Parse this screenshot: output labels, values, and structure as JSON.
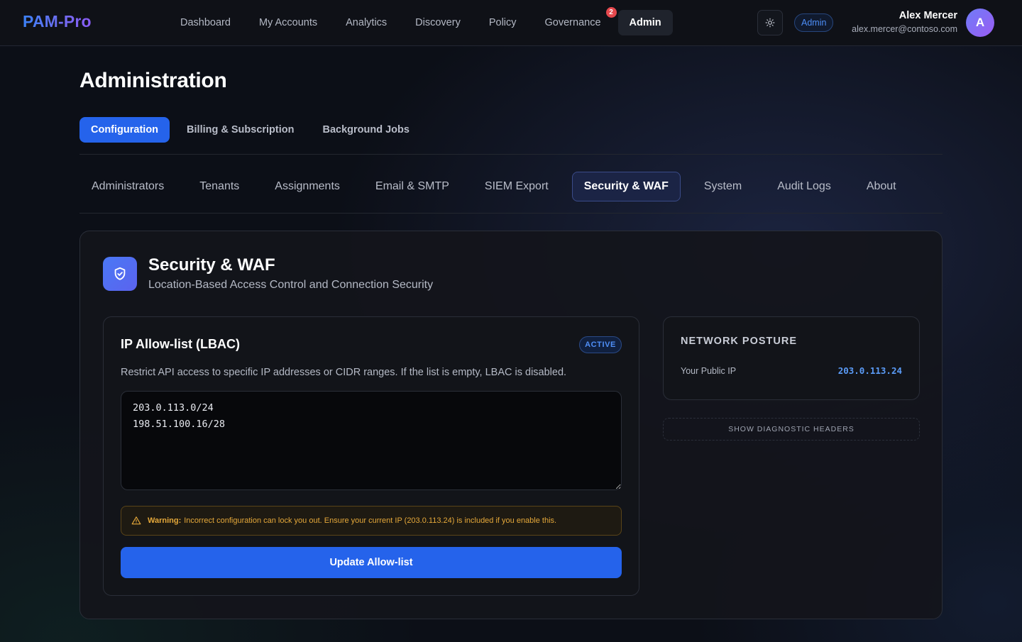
{
  "app": {
    "brand": "PAM-Pro"
  },
  "nav": {
    "items": [
      {
        "label": "Dashboard"
      },
      {
        "label": "My Accounts"
      },
      {
        "label": "Analytics"
      },
      {
        "label": "Discovery"
      },
      {
        "label": "Policy"
      },
      {
        "label": "Governance",
        "badge": "2"
      },
      {
        "label": "Admin",
        "active": true
      }
    ]
  },
  "header": {
    "theme_icon": "sun-icon",
    "role": "Admin",
    "user_name": "Alex Mercer",
    "user_email": "alex.mercer@contoso.com",
    "avatar_initial": "A"
  },
  "page": {
    "title": "Administration",
    "tabs": [
      {
        "label": "Configuration",
        "active": true
      },
      {
        "label": "Billing & Subscription"
      },
      {
        "label": "Background Jobs"
      }
    ],
    "subtabs": [
      {
        "label": "Administrators"
      },
      {
        "label": "Tenants"
      },
      {
        "label": "Assignments"
      },
      {
        "label": "Email & SMTP"
      },
      {
        "label": "SIEM Export"
      },
      {
        "label": "Security & WAF",
        "active": true
      },
      {
        "label": "System"
      },
      {
        "label": "Audit Logs"
      },
      {
        "label": "About"
      }
    ]
  },
  "section": {
    "icon": "shield-check-icon",
    "title": "Security & WAF",
    "subtitle": "Location-Based Access Control and Connection Security"
  },
  "allowlist": {
    "title": "IP Allow-list (LBAC)",
    "status": "ACTIVE",
    "description": "Restrict API access to specific IP addresses or CIDR ranges. If the list is empty, LBAC is disabled.",
    "value": "203.0.113.0/24\n198.51.100.16/28",
    "warning_label": "Warning:",
    "warning_text": "Incorrect configuration can lock you out. Ensure your current IP (203.0.113.24) is included if you enable this.",
    "warning_icon": "alert-triangle-icon",
    "submit_label": "Update Allow-list"
  },
  "posture": {
    "title": "NETWORK POSTURE",
    "public_ip_label": "Your Public IP",
    "public_ip_value": "203.0.113.24",
    "diagnostic_label": "SHOW DIAGNOSTIC HEADERS"
  },
  "colors": {
    "accent": "#2563eb",
    "badge_red": "#e5484d",
    "warning": "#e5a83a"
  }
}
